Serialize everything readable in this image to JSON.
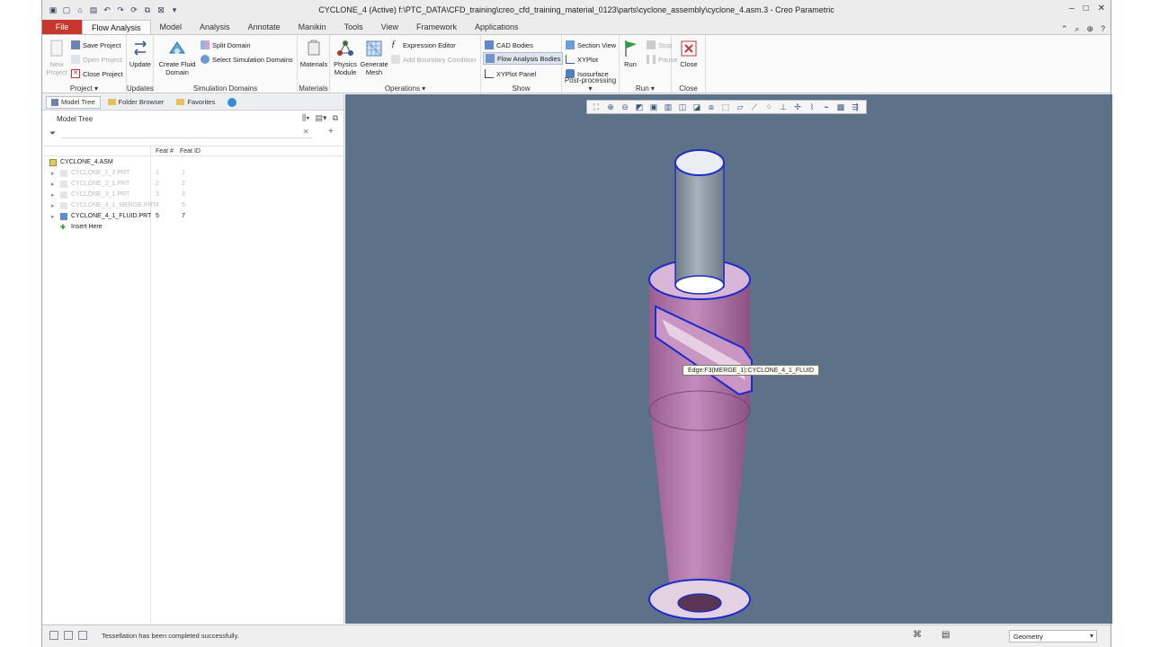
{
  "window": {
    "title": "CYCLONE_4 (Active) f:\\PTC_DATA\\CFD_training\\creo_cfd_training_material_0123\\parts\\cyclone_assembly\\cyclone_4.asm.3 - Creo Parametric",
    "minimize": "–",
    "maximize": "□",
    "close": "✕"
  },
  "tabs": [
    "File",
    "Flow Analysis",
    "Model",
    "Analysis",
    "Annotate",
    "Manikin",
    "Tools",
    "View",
    "Framework",
    "Applications"
  ],
  "active_tab": "Flow Analysis",
  "ribbon": {
    "project": {
      "label": "Project ▾",
      "new_project": "New Project",
      "save_project": "Save Project",
      "open_project": "Open Project",
      "close_project": "Close Project"
    },
    "updates": {
      "label": "Updates",
      "update": "Update"
    },
    "simulation_domains": {
      "label": "Simulation Domains",
      "create_fluid_domain": "Create Fluid Domain",
      "split_domain": "Split Domain",
      "select_simulation_domains": "Select Simulation Domains"
    },
    "materials": {
      "label": "Materials",
      "materials": "Materials"
    },
    "operations": {
      "label": "Operations ▾",
      "physics_module": "Physics Module",
      "generate_mesh": "Generate Mesh",
      "expression_editor": "Expression Editor",
      "add_boundary_condition": "Add Boundary Condition"
    },
    "show": {
      "label": "Show",
      "cad_bodies": "CAD Bodies",
      "flow_analysis_bodies": "Flow Analysis Bodies",
      "xyplot_panel": "XYPlot Panel"
    },
    "post_processing": {
      "label": "Post-processing ▾",
      "section_view": "Section View",
      "xyplot": "XYPlot",
      "isosurface": "Isosurface"
    },
    "run": {
      "label": "Run ▾",
      "run": "Run",
      "stop": "Stop",
      "pause": "Pause"
    },
    "close": {
      "label": "Close",
      "close": "Close"
    }
  },
  "navigator": {
    "tabs": [
      "Model Tree",
      "Folder Browser",
      "Favorites"
    ],
    "tree_title": "Model Tree",
    "columns": [
      "Feat #",
      "Feat ID"
    ],
    "root": "CYCLONE_4.ASM",
    "rows": [
      {
        "name": "CYCLONE_1_2.PRT",
        "feat_num": "1",
        "feat_id": "1",
        "faded": true
      },
      {
        "name": "CYCLONE_2_1.PRT",
        "feat_num": "2",
        "feat_id": "2",
        "faded": true
      },
      {
        "name": "CYCLONE_3_1.PRT",
        "feat_num": "3",
        "feat_id": "3",
        "faded": true
      },
      {
        "name": "CYCLONE_4_1_MERGE.PRT",
        "feat_num": "4",
        "feat_id": "5",
        "faded": true
      },
      {
        "name": "CYCLONE_4_1_FLUID.PRT",
        "feat_num": "5",
        "feat_id": "7",
        "faded": false
      }
    ],
    "insert_here": "Insert Here"
  },
  "viewport": {
    "tooltip": "Edge:F3(MERGE_1):CYCLONE_4_1_FLUID"
  },
  "status": {
    "message": "Tessellation has been completed successfully.",
    "filter": "Geometry"
  },
  "colors": {
    "file_tab": "#c8372d",
    "viewport_bg": "#5d7289",
    "body_pink": "#b57fb0",
    "pipe_gray": "#8e9aa6",
    "edge_blue": "#1a2ccc"
  }
}
